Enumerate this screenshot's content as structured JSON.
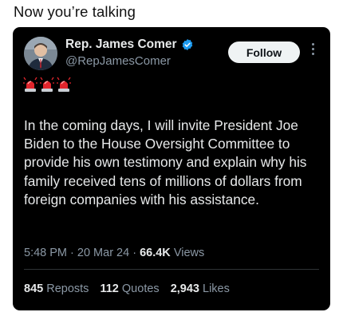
{
  "caption": "Now you’re talking",
  "tweet": {
    "author_name": "Rep. James Comer",
    "handle": "@RepJamesComer",
    "follow_label": "Follow",
    "sirens": [
      "police-car-light-emoji",
      "police-car-light-emoji",
      "police-car-light-emoji"
    ],
    "text": "In the coming days, I will invite President Joe Biden to the House Oversight Committee to provide his own testimony and explain why his family received tens of millions of dollars from foreign companies with his assistance.",
    "time": "5:48 PM",
    "date": "20 Mar 24",
    "views_count": "66.4K",
    "views_label": "Views",
    "reposts_count": "845",
    "reposts_label": "Reposts",
    "quotes_count": "112",
    "quotes_label": "Quotes",
    "likes_count": "2,943",
    "likes_label": "Likes"
  },
  "colors": {
    "card_bg": "#000000",
    "text": "#e7e9ea",
    "secondary": "#8b98a5",
    "verified": "#1d9bf0",
    "siren_red": "#e0252c"
  }
}
